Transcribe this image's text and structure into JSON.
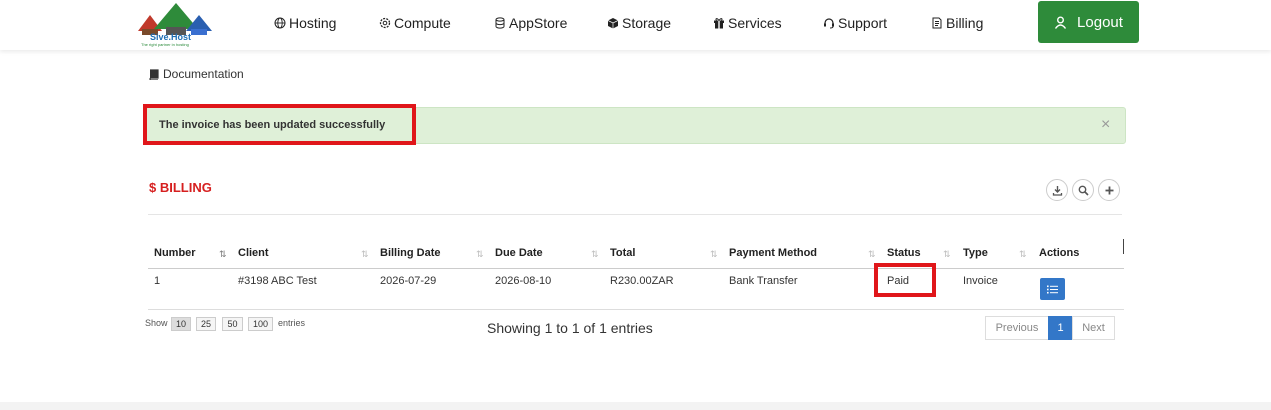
{
  "brand": {
    "name": "Sive.Host",
    "tagline": "The right partner in hosting"
  },
  "nav": [
    {
      "label": "Hosting",
      "icon": "globe-icon"
    },
    {
      "label": "Compute",
      "icon": "gear-icon"
    },
    {
      "label": "AppStore",
      "icon": "database-icon"
    },
    {
      "label": "Storage",
      "icon": "cube-icon"
    },
    {
      "label": "Services",
      "icon": "gift-icon"
    },
    {
      "label": "Support",
      "icon": "headset-icon"
    },
    {
      "label": "Billing",
      "icon": "invoice-icon"
    }
  ],
  "logout_label": "Logout",
  "documentation_label": "Documentation",
  "alert": {
    "message": "The invoice has been updated successfully",
    "close": "×"
  },
  "billing_title": "$ BILLING",
  "table": {
    "headers": [
      "Number",
      "Client",
      "Billing Date",
      "Due Date",
      "Total",
      "Payment Method",
      "Status",
      "Type",
      "Actions"
    ],
    "rows": [
      {
        "number": "1",
        "client": "#3198 ABC Test",
        "billing_date": "2026-07-29",
        "due_date": "2026-08-10",
        "total": "R230.00ZAR",
        "payment_method": "Bank Transfer",
        "status": "Paid",
        "type": "Invoice"
      }
    ]
  },
  "length_menu": {
    "show": "Show",
    "options": [
      "10",
      "25",
      "50",
      "100"
    ],
    "selected": "10",
    "entries": "entries"
  },
  "info": "Showing 1 to 1 of 1 entries",
  "pagination": {
    "previous": "Previous",
    "current": "1",
    "next": "Next"
  },
  "colors": {
    "brand_green": "#2e8b3a",
    "billing_red": "#d61f1f",
    "alert_bg": "#dff0d8",
    "highlight": "#e0161a",
    "primary_blue": "#3377c8"
  }
}
